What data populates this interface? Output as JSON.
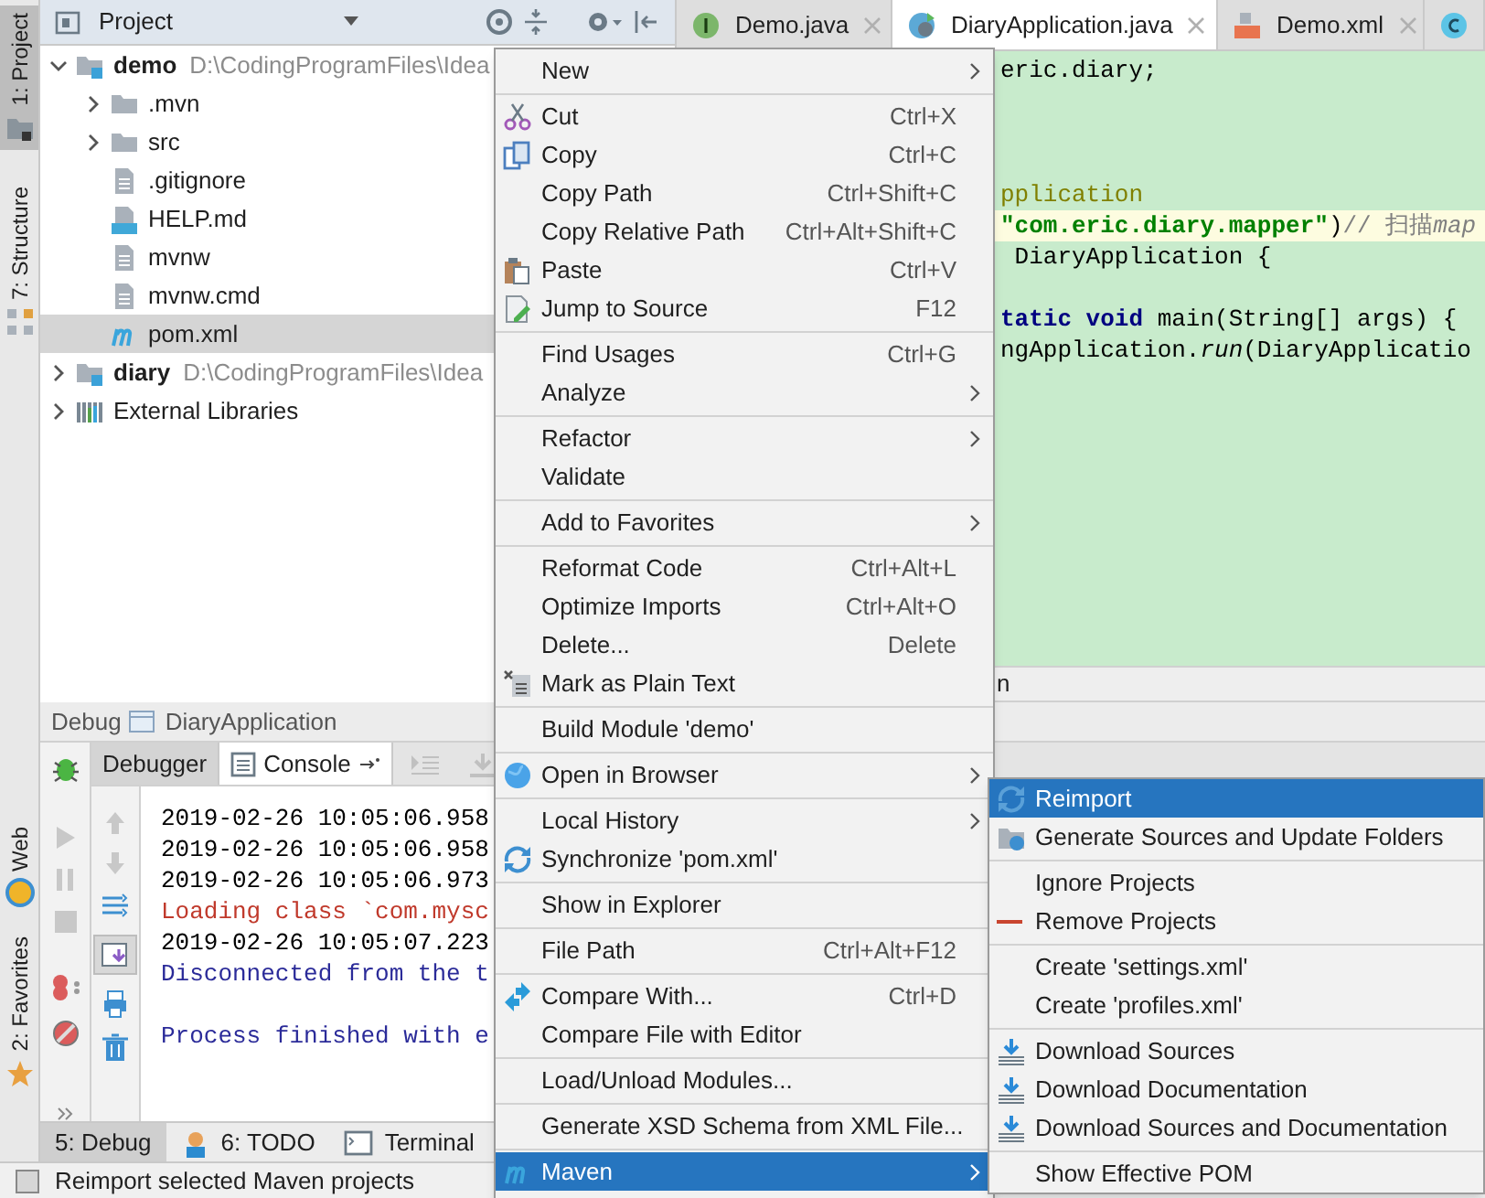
{
  "side_strip": [
    {
      "label": "1: Project",
      "kind": "project",
      "selected": true
    },
    {
      "label": "7: Structure",
      "kind": "structure",
      "selected": false
    },
    {
      "label": "Web",
      "kind": "web",
      "selected": false
    },
    {
      "label": "2: Favorites",
      "kind": "favorites",
      "selected": false
    }
  ],
  "project_panel": {
    "title": "Project"
  },
  "project_tree": [
    {
      "label": "demo",
      "path": "D:\\CodingProgramFiles\\Idea",
      "kind": "module",
      "expanded": true,
      "selected": false,
      "children": [
        {
          "label": ".mvn",
          "kind": "folder",
          "expanded": false,
          "selected": false
        },
        {
          "label": "src",
          "kind": "folder",
          "expanded": false,
          "selected": false
        },
        {
          "label": ".gitignore",
          "kind": "file",
          "selected": false
        },
        {
          "label": "HELP.md",
          "kind": "markdown",
          "selected": false
        },
        {
          "label": "mvnw",
          "kind": "file",
          "selected": false
        },
        {
          "label": "mvnw.cmd",
          "kind": "file",
          "selected": false
        },
        {
          "label": "pom.xml",
          "kind": "maven",
          "selected": true
        }
      ]
    },
    {
      "label": "diary",
      "path": "D:\\CodingProgramFiles\\Idea",
      "kind": "module",
      "expanded": false,
      "selected": false
    },
    {
      "label": "External Libraries",
      "kind": "libraries",
      "expanded": false,
      "selected": false
    }
  ],
  "editor_tabs": [
    {
      "label": "Demo.java",
      "kind": "interface",
      "selected": false
    },
    {
      "label": "DiaryApplication.java",
      "kind": "spring",
      "selected": true
    },
    {
      "label": "Demo.xml",
      "kind": "xml",
      "selected": false
    },
    {
      "kind": "class",
      "selected": false
    }
  ],
  "code_lines": [
    {
      "current": false,
      "segments": [
        {
          "text": "eric.diary;",
          "kind": "plain"
        }
      ]
    },
    {
      "current": false
    },
    {
      "current": false
    },
    {
      "current": false
    },
    {
      "current": false,
      "segments": [
        {
          "text": "pplication",
          "kind": "annotation"
        }
      ]
    },
    {
      "current": true,
      "segments": [
        {
          "text": "\"com.eric.diary.mapper\"",
          "kind": "string"
        },
        {
          "text": ")",
          "kind": "plain"
        },
        {
          "text": "// 扫描",
          "kind": "comment"
        },
        {
          "text": "map",
          "kind": "comment_italic"
        }
      ]
    },
    {
      "current": false,
      "segments": [
        {
          "text": " DiaryApplication {",
          "kind": "plain"
        }
      ]
    },
    {
      "current": false
    },
    {
      "current": false,
      "segments": [
        {
          "text": "tatic void",
          "kind": "keyword"
        },
        {
          "text": " main(String[] args) {",
          "kind": "plain"
        }
      ]
    },
    {
      "current": false,
      "segments": [
        {
          "text": "ngApplication.",
          "kind": "plain"
        },
        {
          "text": "run",
          "kind": "italic"
        },
        {
          "text": "(DiaryApplicatio",
          "kind": "plain"
        }
      ]
    }
  ],
  "breadcrumb": "n",
  "debug_panel": {
    "title": "Debug",
    "config": "DiaryApplication",
    "tabs": [
      {
        "label": "Debugger",
        "selected": false
      },
      {
        "label": "Console",
        "selected": true
      }
    ],
    "console_lines": [
      {
        "text": "2019-02-26 10:05:06.958",
        "kind": "normal"
      },
      {
        "text": "2019-02-26 10:05:06.958",
        "kind": "normal"
      },
      {
        "text": "2019-02-26 10:05:06.973",
        "kind": "normal"
      },
      {
        "text": "Loading class `com.mysc",
        "kind": "error"
      },
      {
        "text": "2019-02-26 10:05:07.223",
        "kind": "normal"
      },
      {
        "text": "Disconnected from the t",
        "kind": "system"
      },
      {
        "kind": "blank"
      },
      {
        "text": "Process finished with e",
        "kind": "system"
      }
    ]
  },
  "tool_tabs": [
    {
      "label": "5: Debug",
      "kind": "debug",
      "selected": true
    },
    {
      "label": "6: TODO",
      "kind": "todo",
      "selected": false
    },
    {
      "label": "Terminal",
      "kind": "terminal",
      "selected": false
    }
  ],
  "status_bar": "Reimport selected Maven projects",
  "context_menu": [
    [
      {
        "label": "New",
        "kind": "plain",
        "submenu": true,
        "selected": false
      }
    ],
    [
      {
        "label": "Cut",
        "shortcut": "Ctrl+X",
        "kind": "cut",
        "submenu": false,
        "selected": false
      },
      {
        "label": "Copy",
        "shortcut": "Ctrl+C",
        "kind": "copy",
        "submenu": false,
        "selected": false
      },
      {
        "label": "Copy Path",
        "shortcut": "Ctrl+Shift+C",
        "kind": "plain",
        "submenu": false,
        "selected": false
      },
      {
        "label": "Copy Relative Path",
        "shortcut": "Ctrl+Alt+Shift+C",
        "kind": "plain",
        "submenu": false,
        "selected": false
      },
      {
        "label": "Paste",
        "shortcut": "Ctrl+V",
        "kind": "paste",
        "submenu": false,
        "selected": false
      },
      {
        "label": "Jump to Source",
        "shortcut": "F12",
        "kind": "jump",
        "submenu": false,
        "selected": false
      }
    ],
    [
      {
        "label": "Find Usages",
        "shortcut": "Ctrl+G",
        "kind": "plain",
        "submenu": false,
        "selected": false
      },
      {
        "label": "Analyze",
        "kind": "plain",
        "submenu": true,
        "selected": false
      }
    ],
    [
      {
        "label": "Refactor",
        "kind": "plain",
        "submenu": true,
        "selected": false
      },
      {
        "label": "Validate",
        "kind": "plain",
        "submenu": false,
        "selected": false
      }
    ],
    [
      {
        "label": "Add to Favorites",
        "kind": "plain",
        "submenu": true,
        "selected": false
      }
    ],
    [
      {
        "label": "Reformat Code",
        "shortcut": "Ctrl+Alt+L",
        "kind": "plain",
        "submenu": false,
        "selected": false
      },
      {
        "label": "Optimize Imports",
        "shortcut": "Ctrl+Alt+O",
        "kind": "plain",
        "submenu": false,
        "selected": false
      },
      {
        "label": "Delete...",
        "shortcut": "Delete",
        "kind": "plain",
        "submenu": false,
        "selected": false
      },
      {
        "label": "Mark as Plain Text",
        "kind": "mark",
        "submenu": false,
        "selected": false
      }
    ],
    [
      {
        "label": "Build Module 'demo'",
        "kind": "plain",
        "submenu": false,
        "selected": false
      }
    ],
    [
      {
        "label": "Open in Browser",
        "kind": "browser",
        "submenu": true,
        "selected": false
      }
    ],
    [
      {
        "label": "Local History",
        "kind": "plain",
        "submenu": true,
        "selected": false
      },
      {
        "label": "Synchronize 'pom.xml'",
        "kind": "sync",
        "submenu": false,
        "selected": false
      }
    ],
    [
      {
        "label": "Show in Explorer",
        "kind": "plain",
        "submenu": false,
        "selected": false
      }
    ],
    [
      {
        "label": "File Path",
        "shortcut": "Ctrl+Alt+F12",
        "kind": "plain",
        "submenu": false,
        "selected": false
      }
    ],
    [
      {
        "label": "Compare With...",
        "shortcut": "Ctrl+D",
        "kind": "compare",
        "submenu": false,
        "selected": false
      },
      {
        "label": "Compare File with Editor",
        "kind": "plain",
        "submenu": false,
        "selected": false
      }
    ],
    [
      {
        "label": "Load/Unload Modules...",
        "kind": "plain",
        "submenu": false,
        "selected": false
      }
    ],
    [
      {
        "label": "Generate XSD Schema from XML File...",
        "kind": "plain",
        "submenu": false,
        "selected": false
      }
    ],
    [
      {
        "label": "Maven",
        "kind": "maven",
        "submenu": true,
        "selected": true
      }
    ]
  ],
  "maven_submenu": [
    [
      {
        "label": "Reimport",
        "kind": "reimport",
        "selected": true
      },
      {
        "label": "Generate Sources and Update Folders",
        "kind": "generate",
        "selected": false
      }
    ],
    [
      {
        "label": "Ignore Projects",
        "kind": "plain",
        "selected": false
      },
      {
        "label": "Remove Projects",
        "kind": "remove",
        "selected": false
      }
    ],
    [
      {
        "label": "Create 'settings.xml'",
        "kind": "plain",
        "selected": false
      },
      {
        "label": "Create 'profiles.xml'",
        "kind": "plain",
        "selected": false
      }
    ],
    [
      {
        "label": "Download Sources",
        "kind": "download",
        "selected": false
      },
      {
        "label": "Download Documentation",
        "kind": "download",
        "selected": false
      },
      {
        "label": "Download Sources and Documentation",
        "kind": "download",
        "selected": false
      }
    ],
    [
      {
        "label": "Show Effective POM",
        "kind": "plain",
        "selected": false
      }
    ]
  ]
}
